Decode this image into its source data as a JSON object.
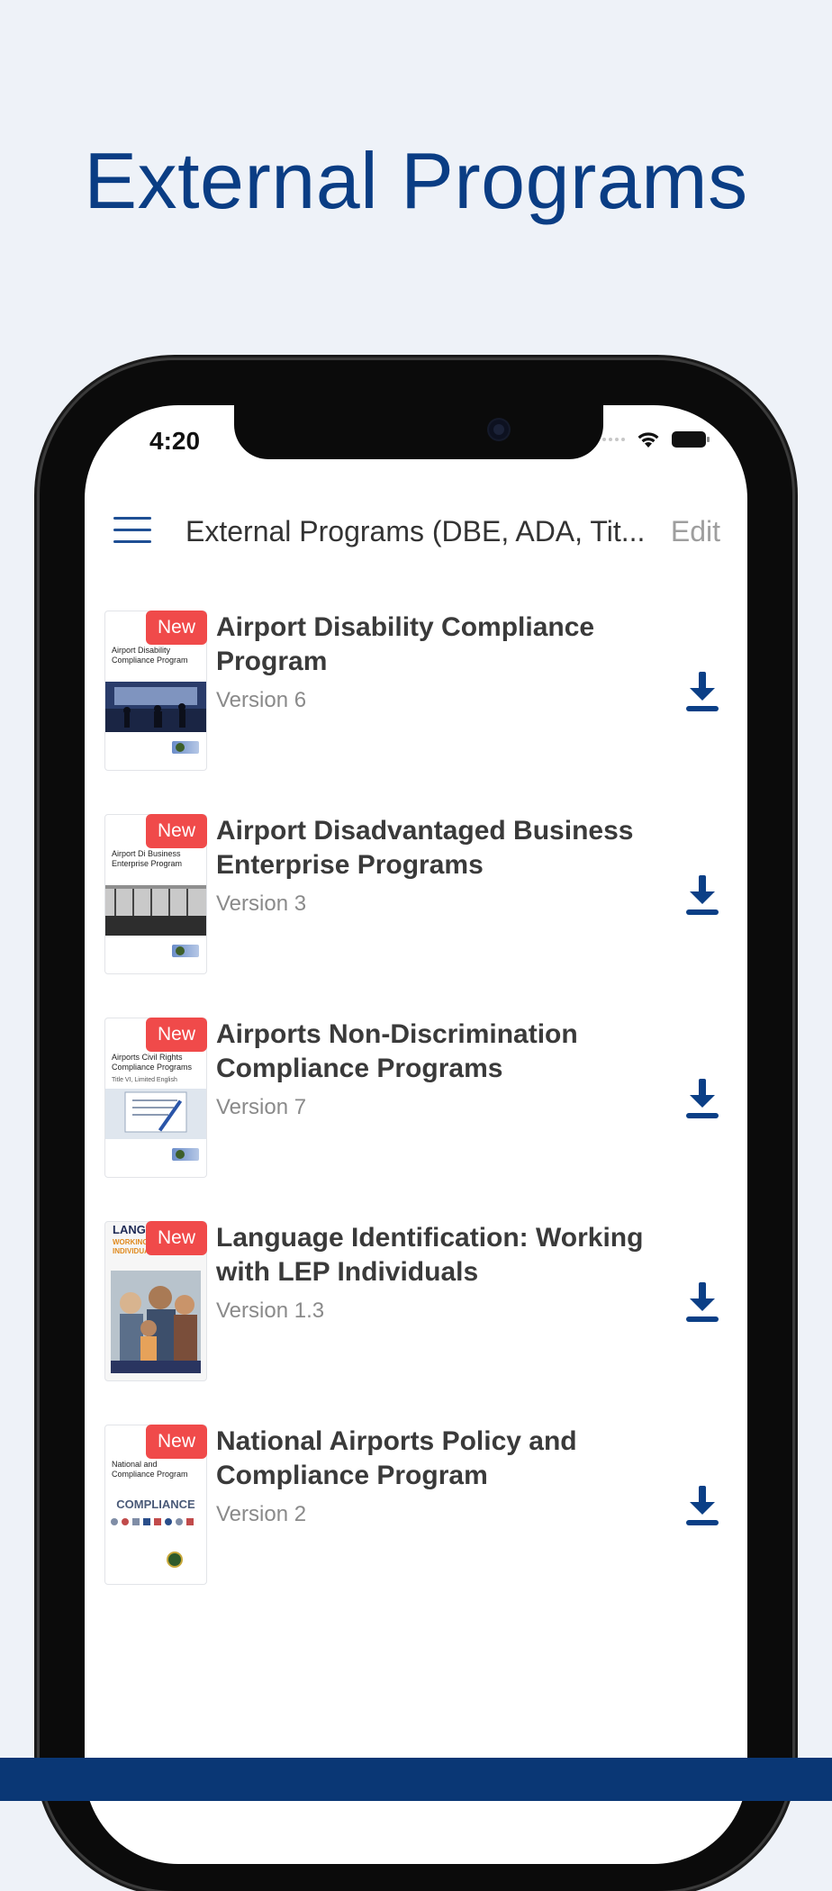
{
  "hero": {
    "title": "External Programs"
  },
  "status_bar": {
    "time": "4:20"
  },
  "navbar": {
    "title": "External Programs (DBE, ADA, Tit...",
    "edit_label": "Edit"
  },
  "badge_label": "New",
  "items": [
    {
      "title": "Airport Disability Compliance Program",
      "version": "Version 6",
      "cover_text": "Airport Disability Compliance Program"
    },
    {
      "title": "Airport Disadvantaged Business Enterprise Programs",
      "version": "Version 3",
      "cover_text": "Airport Di Business Enterprise Program"
    },
    {
      "title": "Airports Non-Discrimination Compliance Programs",
      "version": "Version 7",
      "cover_text": "Airports Civil Rights Compliance Programs",
      "cover_subtext": "Title VI, Limited English"
    },
    {
      "title": "Language Identification: Working with LEP Individuals",
      "version": "Version 1.3",
      "cover_text": "LANGU IDENT",
      "cover_subtext": "WORKING LEP INDIVIDUALS"
    },
    {
      "title": "National Airports Policy and Compliance Program",
      "version": "Version 2",
      "cover_text": "National and Compliance Program",
      "cover_subtext": "COMPLIANCE"
    }
  ],
  "colors": {
    "brand_blue": "#0a3d84",
    "badge_red": "#f04a4a",
    "download_icon": "#0b3f86",
    "background": "#eef2f8"
  },
  "icons": {
    "menu": "hamburger-menu-icon",
    "download": "download-arrow-icon",
    "wifi": "wifi-icon",
    "battery": "battery-icon"
  }
}
